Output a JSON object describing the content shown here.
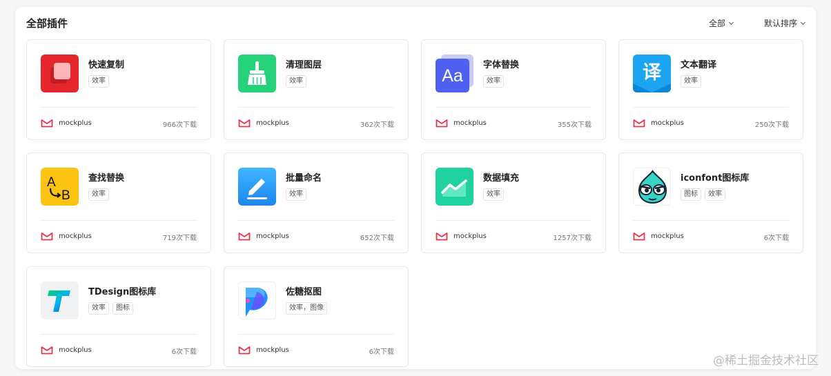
{
  "header": {
    "title": "全部插件",
    "filter_label": "全部",
    "sort_label": "默认排序"
  },
  "plugins": [
    {
      "name": "快速复制",
      "tags": [
        "效率"
      ],
      "author": "mockplus",
      "downloads": "966次下载",
      "icon": "quick-copy-icon"
    },
    {
      "name": "清理图层",
      "tags": [
        "效率"
      ],
      "author": "mockplus",
      "downloads": "362次下载",
      "icon": "broom-icon"
    },
    {
      "name": "字体替换",
      "tags": [
        "效率"
      ],
      "author": "mockplus",
      "downloads": "355次下载",
      "icon": "font-replace-icon"
    },
    {
      "name": "文本翻译",
      "tags": [
        "效率"
      ],
      "author": "mockplus",
      "downloads": "250次下载",
      "icon": "translate-icon"
    },
    {
      "name": "查找替换",
      "tags": [
        "效率"
      ],
      "author": "mockplus",
      "downloads": "719次下载",
      "icon": "find-replace-icon"
    },
    {
      "name": "批量命名",
      "tags": [
        "效率"
      ],
      "author": "mockplus",
      "downloads": "652次下载",
      "icon": "pen-icon"
    },
    {
      "name": "数据填充",
      "tags": [
        "效率"
      ],
      "author": "mockplus",
      "downloads": "1257次下载",
      "icon": "chart-icon"
    },
    {
      "name": "iconfont图标库",
      "tags": [
        "图标",
        "效率"
      ],
      "author": "mockplus",
      "downloads": "6次下载",
      "icon": "iconfont-mascot-icon"
    },
    {
      "name": "TDesign图标库",
      "tags": [
        "效率",
        "图标"
      ],
      "author": "mockplus",
      "downloads": "6次下载",
      "icon": "tdesign-icon"
    },
    {
      "name": "佐糖抠图",
      "tags": [
        "效率，图像"
      ],
      "author": "mockplus",
      "downloads": "6次下载",
      "icon": "cutout-icon"
    }
  ],
  "watermark": "@稀土掘金技术社区",
  "colors": {
    "brand": "#e8334a",
    "accent_blue": "#1e90ff",
    "text": "#222222",
    "muted": "#777777"
  }
}
